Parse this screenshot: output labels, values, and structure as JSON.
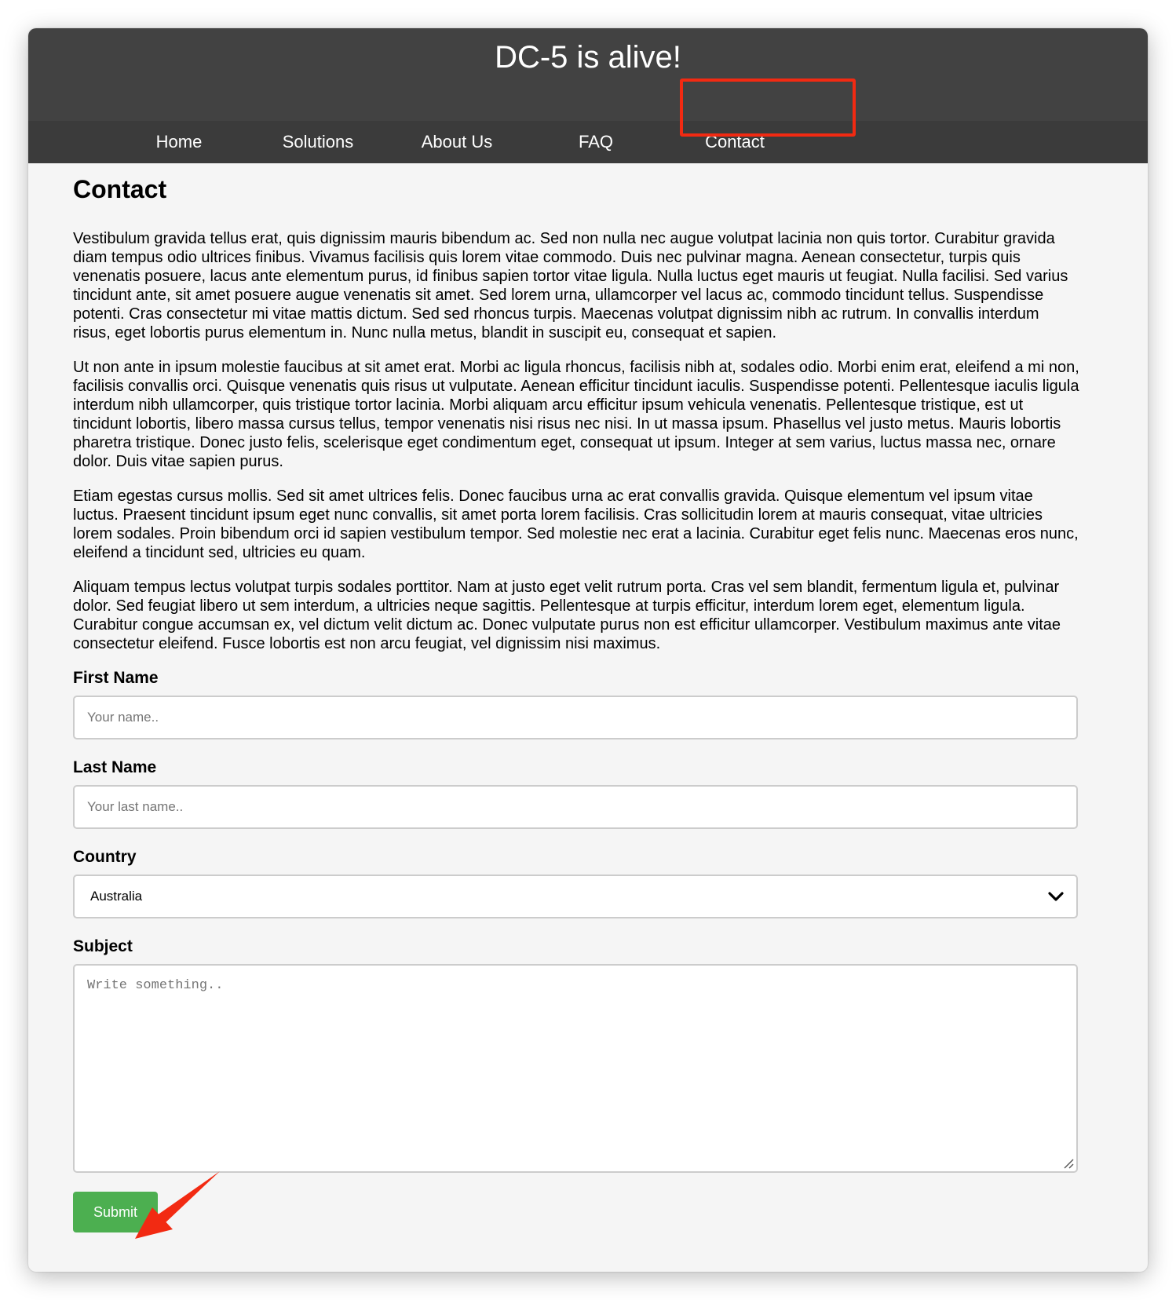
{
  "header": {
    "title": "DC-5 is alive!"
  },
  "nav": {
    "items": [
      {
        "label": "Home"
      },
      {
        "label": "Solutions"
      },
      {
        "label": "About Us"
      },
      {
        "label": "FAQ"
      },
      {
        "label": "Contact"
      }
    ],
    "highlighted": "Contact"
  },
  "main": {
    "heading": "Contact",
    "paragraphs": [
      "Vestibulum gravida tellus erat, quis dignissim mauris bibendum ac. Sed non nulla nec augue volutpat lacinia non quis tortor. Curabitur gravida diam tempus odio ultrices finibus. Vivamus facilisis quis lorem vitae commodo. Duis nec pulvinar magna. Aenean consectetur, turpis quis venenatis posuere, lacus ante elementum purus, id finibus sapien tortor vitae ligula. Nulla luctus eget mauris ut feugiat. Nulla facilisi. Sed varius tincidunt ante, sit amet posuere augue venenatis sit amet. Sed lorem urna, ullamcorper vel lacus ac, commodo tincidunt tellus. Suspendisse potenti. Cras consectetur mi vitae mattis dictum. Sed sed rhoncus turpis. Maecenas volutpat dignissim nibh ac rutrum. In convallis interdum risus, eget lobortis purus elementum in. Nunc nulla metus, blandit in suscipit eu, consequat et sapien.",
      "Ut non ante in ipsum molestie faucibus at sit amet erat. Morbi ac ligula rhoncus, facilisis nibh at, sodales odio. Morbi enim erat, eleifend a mi non, facilisis convallis orci. Quisque venenatis quis risus ut vulputate. Aenean efficitur tincidunt iaculis. Suspendisse potenti. Pellentesque iaculis ligula interdum nibh ullamcorper, quis tristique tortor lacinia. Morbi aliquam arcu efficitur ipsum vehicula venenatis. Pellentesque tristique, est ut tincidunt lobortis, libero massa cursus tellus, tempor venenatis nisi risus nec nisi. In ut massa ipsum. Phasellus vel justo metus. Mauris lobortis pharetra tristique. Donec justo felis, scelerisque eget condimentum eget, consequat ut ipsum. Integer at sem varius, luctus massa nec, ornare dolor. Duis vitae sapien purus.",
      "Etiam egestas cursus mollis. Sed sit amet ultrices felis. Donec faucibus urna ac erat convallis gravida. Quisque elementum vel ipsum vitae luctus. Praesent tincidunt ipsum eget nunc convallis, sit amet porta lorem facilisis. Cras sollicitudin lorem at mauris consequat, vitae ultricies lorem sodales. Proin bibendum orci id sapien vestibulum tempor. Sed molestie nec erat a lacinia. Curabitur eget felis nunc. Maecenas eros nunc, eleifend a tincidunt sed, ultricies eu quam.",
      "Aliquam tempus lectus volutpat turpis sodales porttitor. Nam at justo eget velit rutrum porta. Cras vel sem blandit, fermentum ligula et, pulvinar dolor. Sed feugiat libero ut sem interdum, a ultricies neque sagittis. Pellentesque at turpis efficitur, interdum lorem eget, elementum ligula. Curabitur congue accumsan ex, vel dictum velit dictum ac. Donec vulputate purus non est efficitur ullamcorper. Vestibulum maximus ante vitae consectetur eleifend. Fusce lobortis est non arcu feugiat, vel dignissim nisi maximus."
    ]
  },
  "form": {
    "first_name": {
      "label": "First Name",
      "placeholder": "Your name..",
      "value": ""
    },
    "last_name": {
      "label": "Last Name",
      "placeholder": "Your last name..",
      "value": ""
    },
    "country": {
      "label": "Country",
      "selected": "Australia"
    },
    "subject": {
      "label": "Subject",
      "placeholder": "Write something..",
      "value": ""
    },
    "submit_label": "Submit"
  },
  "icons": {
    "country_dropdown": "chevron-down-icon",
    "textarea_resize": "resize-grip-icon",
    "annotation_arrow": "arrow-icon"
  },
  "colors": {
    "header_bg": "#424242",
    "nav_bg": "#3b3b3b",
    "page_bg": "#f5f5f5",
    "submit_bg": "#4caf50",
    "annotation": "#f22a12"
  }
}
